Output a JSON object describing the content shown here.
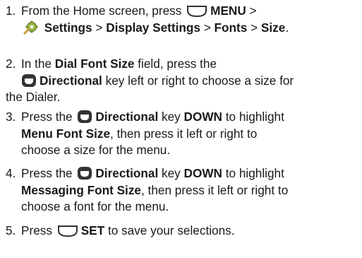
{
  "steps": [
    {
      "num": "1.",
      "l1": "From the Home screen, press",
      "l1_key": "MENU",
      "l1_end": ">",
      "l2_b1": "Settings",
      "sep": ">",
      "l2_b2": "Display Settings",
      "l2_b3": "Fonts",
      "l2_b4": "Size",
      "l2_end": "."
    },
    {
      "num": "2.",
      "l1a": "In the",
      "l1b": "Dial Font Size",
      "l1c": "field, press the",
      "l2b": "Directional",
      "l2c": "key left or right to choose a size for",
      "l3": "the Dialer."
    },
    {
      "num": "3.",
      "l1a": "Press the",
      "l1b": "Directional",
      "l1c": "key",
      "l1d": "DOWN",
      "l1e": "to highlight",
      "l2b": "Menu Font Size",
      "l2c": ", then press it left or right to",
      "l3": "choose a size for the menu."
    },
    {
      "num": "4.",
      "l1a": "Press the",
      "l1b": "Directional",
      "l1c": "key",
      "l1d": "DOWN",
      "l1e": "to highlight",
      "l2b": "Messaging Font Size",
      "l2c": ", then press it left or right to",
      "l3": "choose a font for the menu."
    },
    {
      "num": "5.",
      "l1a": "Press",
      "l1b": "SET",
      "l1c": "to save your selections."
    }
  ],
  "icons": {
    "softkey": "softkey-icon",
    "settings": "settings-icon",
    "directional": "directional-key-icon"
  }
}
